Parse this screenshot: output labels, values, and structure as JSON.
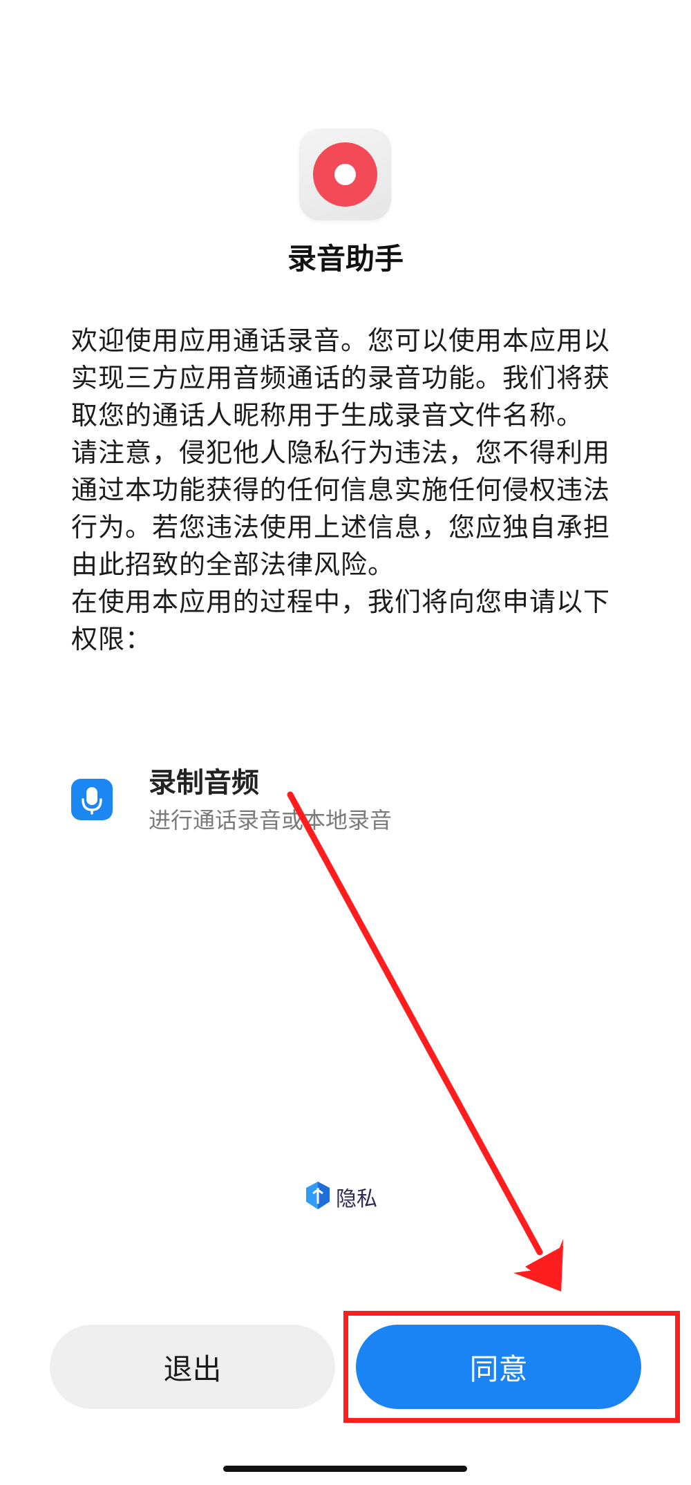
{
  "app": {
    "name": "录音助手",
    "icon": "record-icon",
    "icon_color": "#f24b57"
  },
  "notice": {
    "paragraphs": [
      "欢迎使用应用通话录音。您可以使用本应用以实现三方应用音频通话的录音功能。我们将获取您的通话人昵称用于生成录音文件名称。",
      "请注意，侵犯他人隐私行为违法，您不得利用通过本功能获得的任何信息实施任何侵权违法行为。若您违法使用上述信息，您应独自承担由此招致的全部法律风险。",
      "在使用本应用的过程中，我们将向您申请以下权限："
    ]
  },
  "permissions": [
    {
      "icon": "microphone-icon",
      "title": "录制音频",
      "description": "进行通话录音或本地录音"
    }
  ],
  "privacy": {
    "icon": "privacy-shield-icon",
    "label": "隐私"
  },
  "buttons": {
    "exit_label": "退出",
    "agree_label": "同意"
  },
  "colors": {
    "accent": "#1a84f4",
    "secondary_button": "#efefef",
    "annotation": "#ff1d1d"
  }
}
